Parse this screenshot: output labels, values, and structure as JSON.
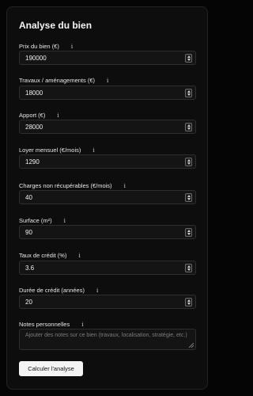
{
  "title": "Analyse du bien",
  "info_glyph": "i",
  "fields": [
    {
      "label": "Prix du bien (€)",
      "value": "190000"
    },
    {
      "label": "Travaux / aménagements (€)",
      "value": "18000"
    },
    {
      "label": "Apport (€)",
      "value": "28000"
    },
    {
      "label": "Loyer mensuel (€/mois)",
      "value": "1290"
    },
    {
      "label": "Charges non récupérables (€/mois)",
      "value": "40"
    },
    {
      "label": "Surface (m²)",
      "value": "90"
    },
    {
      "label": "Taux de crédit (%)",
      "value": "3.6"
    },
    {
      "label": "Durée de crédit (années)",
      "value": "20"
    }
  ],
  "notes": {
    "label": "Notes personnelles",
    "placeholder": "Ajouter des notes sur ce bien (travaux, localisation, stratégie, etc.)"
  },
  "submit_label": "Calculer l'analyse"
}
